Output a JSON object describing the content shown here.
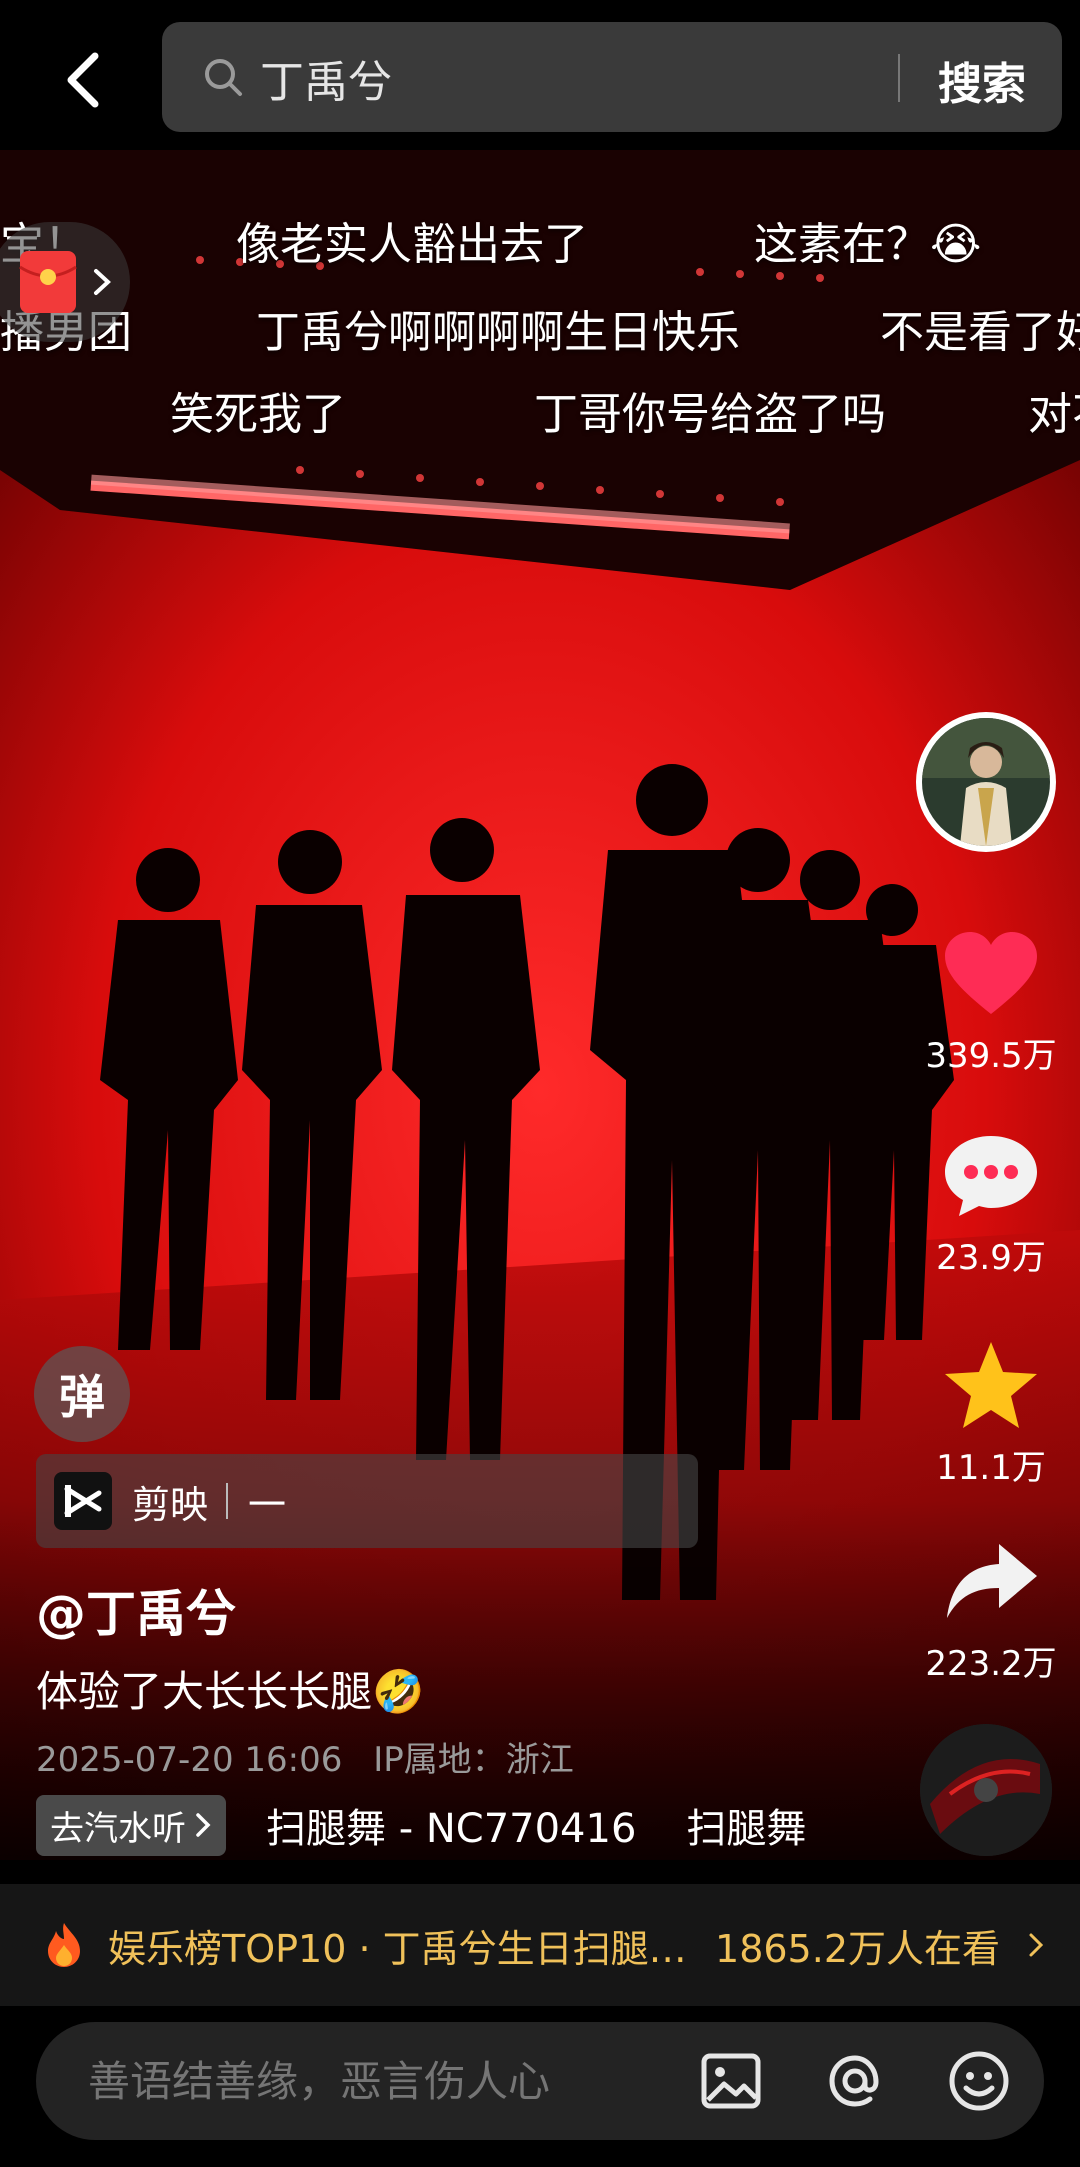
{
  "search": {
    "query": "丁禹兮",
    "button_label": "搜索"
  },
  "danmaku": [
    {
      "text": "宝！"
    },
    {
      "text": "像老实人豁出去了"
    },
    {
      "text": "这素在？😭"
    },
    {
      "text": "播男团"
    },
    {
      "text": "丁禹兮啊啊啊啊生日快乐"
    },
    {
      "text": "不是看了好"
    },
    {
      "text": "笑死我了"
    },
    {
      "text": "丁哥你号给盗了吗"
    },
    {
      "text": "对不"
    }
  ],
  "sidebar": {
    "likes": "339.5万",
    "comments": "23.9万",
    "favorites": "11.1万",
    "shares": "223.2万"
  },
  "danmu_toggle": {
    "label": "弹"
  },
  "capcut": {
    "label": "剪映",
    "dash": "一"
  },
  "post": {
    "author": "@丁禹兮",
    "caption": "体验了大长长长腿🤣",
    "datetime": "2025-07-20 16:06",
    "ip": "IP属地：浙江"
  },
  "music": {
    "qishui_label": "去汽水听",
    "track": "扫腿舞 - NC770416",
    "track_tail": "扫腿舞"
  },
  "rank": {
    "text": "娱乐榜TOP10 · 丁禹兮生日扫腿…",
    "watching": "1865.2万人在看"
  },
  "comment": {
    "placeholder": "善语结善缘，恶言伤人心"
  },
  "colors": {
    "accent_gold": "#f0c15a",
    "heart_pink": "#fe2c55",
    "star_yellow": "#ffc21a"
  }
}
